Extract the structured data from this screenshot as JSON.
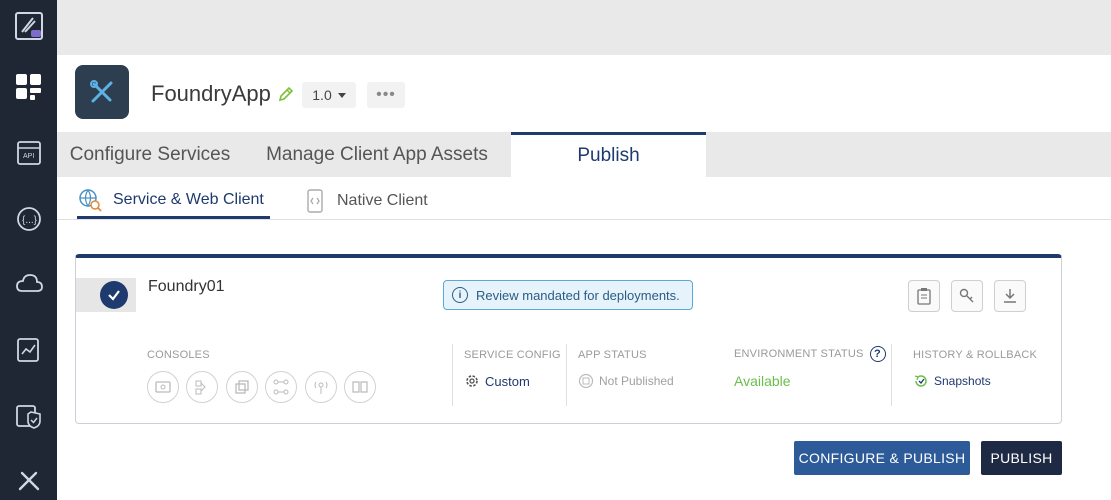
{
  "app": {
    "name": "FoundryApp",
    "version": "1.0",
    "more": "•••"
  },
  "main_tabs": [
    {
      "label": "Configure Services"
    },
    {
      "label": "Manage Client App Assets"
    },
    {
      "label": "Publish",
      "active": true
    }
  ],
  "sub_tabs": [
    {
      "label": "Service & Web Client",
      "active": true
    },
    {
      "label": "Native Client"
    }
  ],
  "card": {
    "title": "Foundry01",
    "review_banner": "Review mandated for deployments.",
    "consoles": {
      "label": "CONSOLES"
    },
    "service_config": {
      "label": "SERVICE CONFIG",
      "value": "Custom"
    },
    "app_status": {
      "label": "APP STATUS",
      "value": "Not Published"
    },
    "environment_status": {
      "label": "ENVIRONMENT STATUS",
      "value": "Available",
      "help": "?"
    },
    "history": {
      "label": "HISTORY & ROLLBACK",
      "value": "Snapshots"
    }
  },
  "buttons": {
    "configure_publish": "CONFIGURE & PUBLISH",
    "publish": "PUBLISH"
  },
  "colors": {
    "sidebar": "#1e2733",
    "accent": "#1e3a6e",
    "available": "#6abf4b",
    "configure_button": "#2d5a99",
    "publish_button": "#1e2a44"
  },
  "icons": {
    "sidebar": [
      "foundry-logo-icon",
      "dashboard-icon",
      "api-icon",
      "integration-icon",
      "cloud-icon",
      "analytics-icon",
      "security-icon",
      "settings-tools-icon"
    ]
  }
}
